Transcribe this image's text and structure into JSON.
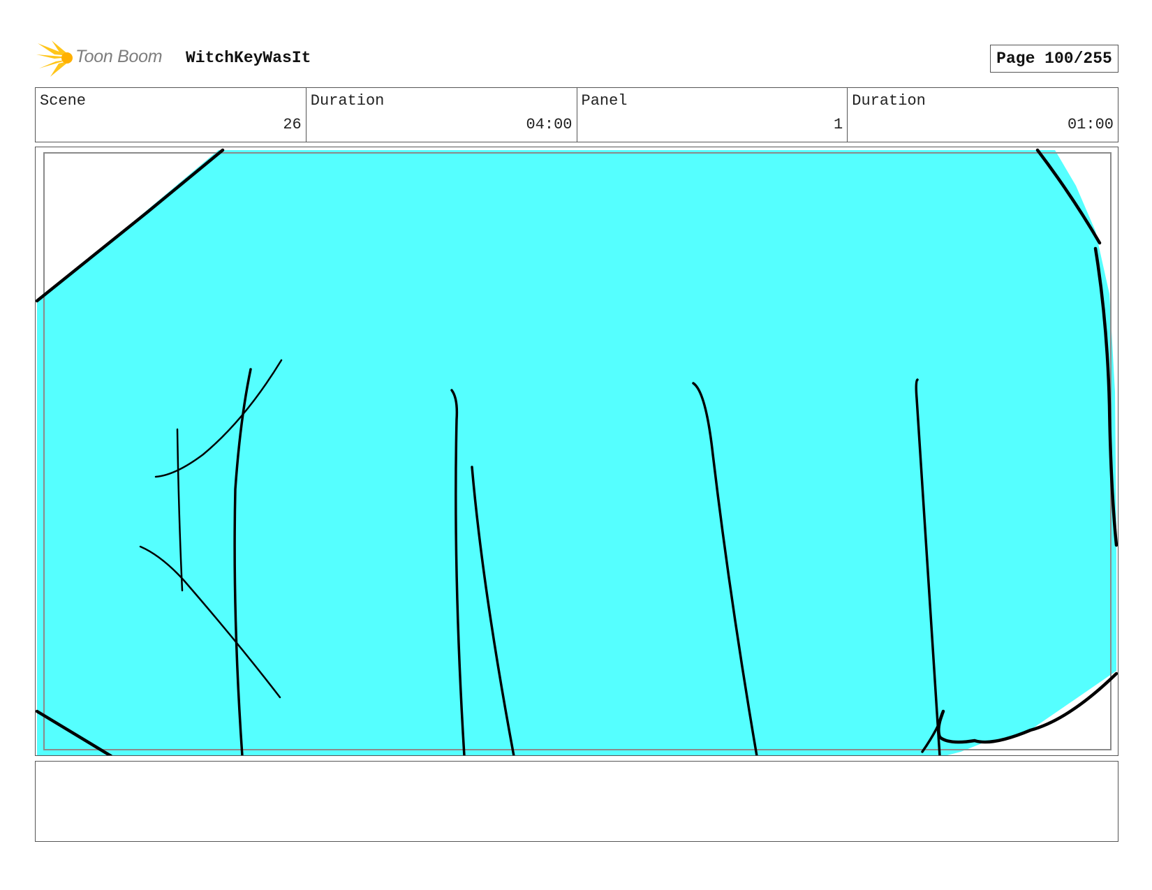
{
  "header": {
    "logo_text": "Toon Boom",
    "project_title": "WitchKeyWasIt",
    "page_label": "Page 100/255"
  },
  "info": {
    "scene_label": "Scene",
    "scene_value": "26",
    "scene_duration_label": "Duration",
    "scene_duration_value": "04:00",
    "panel_label": "Panel",
    "panel_value": "1",
    "panel_duration_label": "Duration",
    "panel_duration_value": "01:00"
  },
  "colors": {
    "fill": "#55ffff",
    "ink": "#000000",
    "logo_flare": "#ffc51a"
  },
  "notes": {
    "text": ""
  }
}
